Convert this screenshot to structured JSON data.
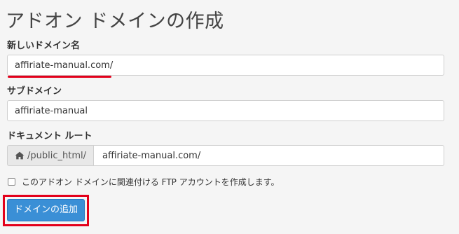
{
  "page": {
    "title": "アドオン ドメインの作成"
  },
  "form": {
    "new_domain": {
      "label": "新しいドメイン名",
      "value": "affiriate-manual.com/"
    },
    "subdomain": {
      "label": "サブドメイン",
      "value": "affiriate-manual"
    },
    "document_root": {
      "label": "ドキュメント ルート",
      "prefix": "/public_html/",
      "value": "affiriate-manual.com/"
    },
    "ftp_checkbox": {
      "label": "このアドオン ドメインに関連付ける FTP アカウントを作成します。",
      "checked": false
    },
    "submit_label": "ドメインの追加"
  },
  "icons": {
    "home": "home-icon"
  },
  "colors": {
    "highlight": "#e3001b",
    "button": "#3a8fd6"
  }
}
